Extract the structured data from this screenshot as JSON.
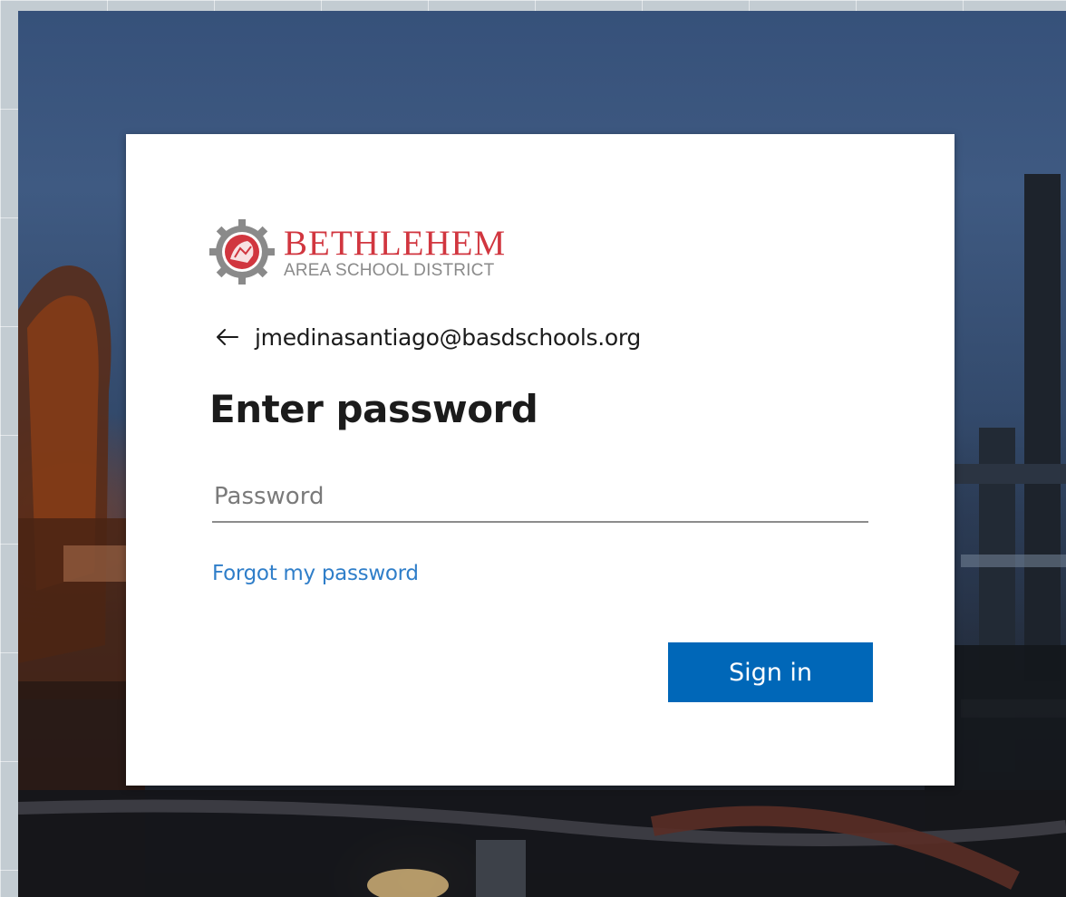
{
  "organization": {
    "logo_name": "BETHLEHEM",
    "logo_subtitle": "AREA SCHOOL DISTRICT"
  },
  "identity": {
    "email": "jmedinasantiago@basdschools.org"
  },
  "heading": "Enter password",
  "password_field": {
    "placeholder": "Password",
    "value": ""
  },
  "forgot_link": "Forgot my password",
  "signin_button": "Sign in",
  "colors": {
    "brand_red": "#d1363f",
    "button_blue": "#0067b8",
    "link_blue": "#2f7ec9",
    "logo_gray": "#8a8a8a"
  },
  "icons": {
    "back": "arrow-left-icon",
    "logo": "gear-seal-icon"
  }
}
